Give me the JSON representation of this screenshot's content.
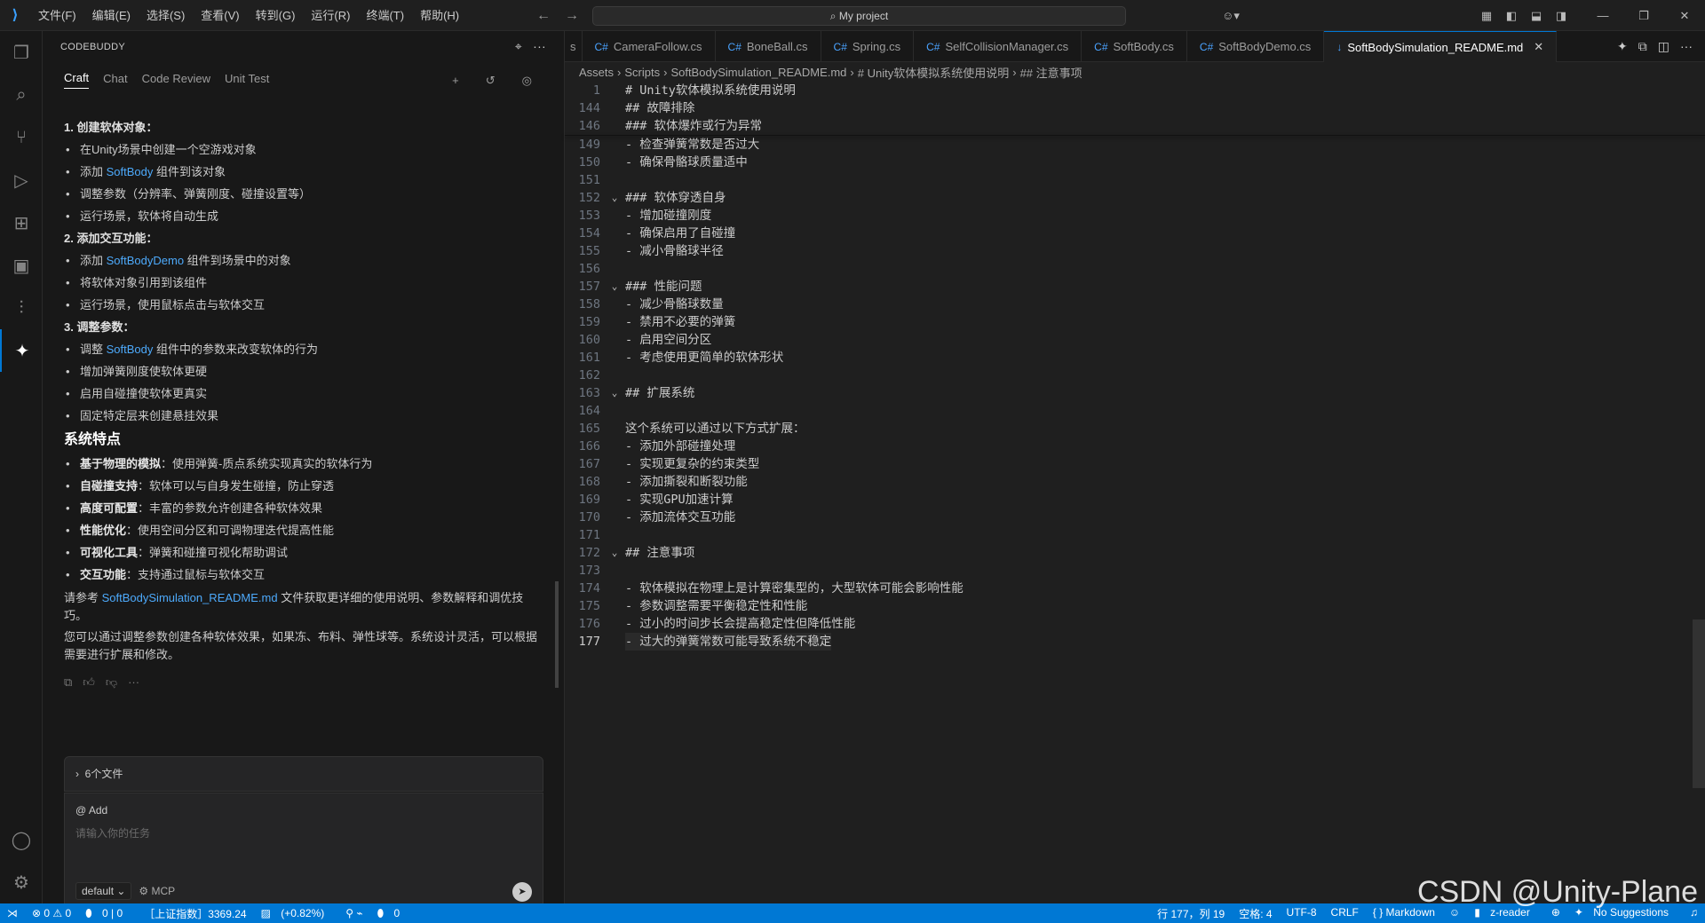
{
  "menu": [
    "文件(F)",
    "编辑(E)",
    "选择(S)",
    "查看(V)",
    "转到(G)",
    "运行(R)",
    "终端(T)",
    "帮助(H)"
  ],
  "search": {
    "text": "My project"
  },
  "sidebar": {
    "title": "CODEBUDDY",
    "tabs": [
      "Craft",
      "Chat",
      "Code Review",
      "Unit Test"
    ],
    "steps": [
      {
        "title": "1. 创建软体对象：",
        "items": [
          [
            {
              "t": "在Unity场景中创建一个空游戏对象"
            }
          ],
          [
            {
              "t": "添加 "
            },
            {
              "t": "SoftBody",
              "hl": true
            },
            {
              "t": " 组件到该对象"
            }
          ],
          [
            {
              "t": "调整参数（分辨率、弹簧刚度、碰撞设置等）"
            }
          ],
          [
            {
              "t": "运行场景，软体将自动生成"
            }
          ]
        ]
      },
      {
        "title": "2. 添加交互功能：",
        "items": [
          [
            {
              "t": "添加 "
            },
            {
              "t": "SoftBodyDemo",
              "hl": true
            },
            {
              "t": " 组件到场景中的对象"
            }
          ],
          [
            {
              "t": "将软体对象引用到该组件"
            }
          ],
          [
            {
              "t": "运行场景，使用鼠标点击与软体交互"
            }
          ]
        ]
      },
      {
        "title": "3. 调整参数：",
        "items": [
          [
            {
              "t": "调整 "
            },
            {
              "t": "SoftBody",
              "hl": true
            },
            {
              "t": " 组件中的参数来改变软体的行为"
            }
          ],
          [
            {
              "t": "增加弹簧刚度使软体更硬"
            }
          ],
          [
            {
              "t": "启用自碰撞使软体更真实"
            }
          ],
          [
            {
              "t": "固定特定层来创建悬挂效果"
            }
          ]
        ]
      }
    ],
    "features_title": "系统特点",
    "features": [
      {
        "k": "基于物理的模拟",
        "v": "：使用弹簧-质点系统实现真实的软体行为"
      },
      {
        "k": "自碰撞支持",
        "v": "：软体可以与自身发生碰撞，防止穿透"
      },
      {
        "k": "高度可配置",
        "v": "：丰富的参数允许创建各种软体效果"
      },
      {
        "k": "性能优化",
        "v": "：使用空间分区和可调物理迭代提高性能"
      },
      {
        "k": "可视化工具",
        "v": "：弹簧和碰撞可视化帮助调试"
      },
      {
        "k": "交互功能",
        "v": "：支持通过鼠标与软体交互"
      }
    ],
    "ref_pre": "请参考 ",
    "ref_link": "SoftBodySimulation_README.md",
    "ref_post": " 文件获取更详细的使用说明、参数解释和调优技巧。",
    "closing": "您可以通过调整参数创建各种软体效果，如果冻、布料、弹性球等。系统设计灵活，可以根据需要进行扩展和修改。",
    "files": "6个文件",
    "add": "@ Add",
    "placeholder": "请输入你的任务",
    "mode": "default",
    "mcp": "MCP"
  },
  "tabs": [
    {
      "label": "CameraFollow.cs",
      "icon": "C#"
    },
    {
      "label": "BoneBall.cs",
      "icon": "C#"
    },
    {
      "label": "Spring.cs",
      "icon": "C#"
    },
    {
      "label": "SelfCollisionManager.cs",
      "icon": "C#"
    },
    {
      "label": "SoftBody.cs",
      "icon": "C#"
    },
    {
      "label": "SoftBodyDemo.cs",
      "icon": "C#"
    },
    {
      "label": "SoftBodySimulation_README.md",
      "icon": "↓",
      "active": true
    }
  ],
  "breadcrumb": [
    "Assets",
    "Scripts",
    "SoftBodySimulation_README.md",
    "# Unity软体模拟系统使用说明",
    "## 注意事项"
  ],
  "sticky_lines": [
    {
      "n": "1",
      "code": "# Unity软体模拟系统使用说明"
    },
    {
      "n": "144",
      "code": "## 故障排除"
    },
    {
      "n": "146",
      "code": "### 软体爆炸或行为异常"
    }
  ],
  "lines": [
    {
      "n": "149",
      "code": "- 检查弹簧常数是否过大"
    },
    {
      "n": "150",
      "code": "- 确保骨骼球质量适中"
    },
    {
      "n": "151",
      "code": ""
    },
    {
      "n": "152",
      "code": "### 软体穿透自身",
      "fold": true
    },
    {
      "n": "153",
      "code": "- 增加碰撞刚度"
    },
    {
      "n": "154",
      "code": "- 确保启用了自碰撞"
    },
    {
      "n": "155",
      "code": "- 减小骨骼球半径"
    },
    {
      "n": "156",
      "code": ""
    },
    {
      "n": "157",
      "code": "### 性能问题",
      "fold": true
    },
    {
      "n": "158",
      "code": "- 减少骨骼球数量"
    },
    {
      "n": "159",
      "code": "- 禁用不必要的弹簧"
    },
    {
      "n": "160",
      "code": "- 启用空间分区"
    },
    {
      "n": "161",
      "code": "- 考虑使用更简单的软体形状"
    },
    {
      "n": "162",
      "code": ""
    },
    {
      "n": "163",
      "code": "## 扩展系统",
      "fold": true
    },
    {
      "n": "164",
      "code": ""
    },
    {
      "n": "165",
      "code": "这个系统可以通过以下方式扩展：",
      "gold": true
    },
    {
      "n": "166",
      "code": "- 添加外部碰撞处理"
    },
    {
      "n": "167",
      "code": "- 实现更复杂的约束类型"
    },
    {
      "n": "168",
      "code": "- 添加撕裂和断裂功能"
    },
    {
      "n": "169",
      "code": "- 实现GPU加速计算"
    },
    {
      "n": "170",
      "code": "- 添加流体交互功能"
    },
    {
      "n": "171",
      "code": ""
    },
    {
      "n": "172",
      "code": "## 注意事项",
      "fold": true
    },
    {
      "n": "173",
      "code": ""
    },
    {
      "n": "174",
      "code": "- 软体模拟在物理上是计算密集型的，大型软体可能会影响性能"
    },
    {
      "n": "175",
      "code": "- 参数调整需要平衡稳定性和性能"
    },
    {
      "n": "176",
      "code": "- 过小的时间步长会提高稳定性但降低性能"
    },
    {
      "n": "177",
      "code": "- 过大的弹簧常数可能导致系统不稳定",
      "current": true
    }
  ],
  "status": {
    "errors": "⊗ 0 ⚠ 0",
    "git": "0 | 0",
    "stock": "［上证指数］3369.24",
    "stock_change": "(+0.82%)",
    "zero": "0",
    "position": "行 177，列 19",
    "spaces": "空格: 4",
    "encoding": "UTF-8",
    "eol": "CRLF",
    "lang": "{ } Markdown",
    "reader": "z-reader",
    "suggest": "No Suggestions"
  },
  "watermark": "CSDN @Unity-Plane"
}
